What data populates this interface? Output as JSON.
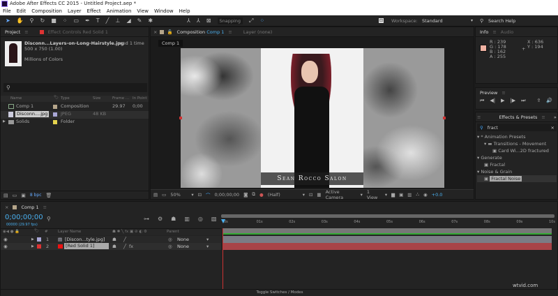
{
  "window": {
    "title": "Adobe After Effects CC 2015 - Untitled Project.aep *"
  },
  "menu": [
    "File",
    "Edit",
    "Composition",
    "Layer",
    "Effect",
    "Animation",
    "View",
    "Window",
    "Help"
  ],
  "toolbar": {
    "snapping": "Snapping",
    "workspace_label": "Workspace:",
    "workspace_value": "Standard",
    "search_help": "Search Help"
  },
  "project": {
    "tab": "Project",
    "effect_controls_tab": "Effect Controls Red Solid 1",
    "item_name": "Disconn...Layers-on-Long-Hairstyle.jpg",
    "used": ", used 1 time",
    "dimensions": "500 x 750 (1.00)",
    "colors": "Millions of Colors",
    "columns": [
      "Name",
      "Type",
      "Size",
      "Frame ...",
      "In Point"
    ],
    "items": [
      {
        "name": "Comp 1",
        "type": "Composition",
        "size": "",
        "frame": "29.97",
        "in": "0;00",
        "color": "#b5a58a"
      },
      {
        "name": "Disconn....jpg",
        "type": "JPEG",
        "size": "48 KB",
        "frame": "",
        "in": "",
        "color": "#a9a7d6"
      },
      {
        "name": "Solids",
        "type": "Folder",
        "size": "",
        "frame": "",
        "in": "",
        "color": "#e4d34d"
      }
    ],
    "bpc": "8 bpc"
  },
  "composition": {
    "tab_label": "Composition",
    "tab_comp": "Comp 1",
    "layer_tab": "Layer (none)",
    "breadcrumb": "Comp 1",
    "banner": "Sean Rocco Salon",
    "footer": {
      "zoom": "50%",
      "timecode": "0;00;00;00",
      "resolution": "(Half)",
      "camera": "Active Camera",
      "view": "1 View",
      "exposure": "+0.0"
    }
  },
  "info": {
    "tab": "Info",
    "audio_tab": "Audio",
    "swatch": "#efb2a2",
    "r": "R : 239",
    "g": "G : 178",
    "b": "B : 162",
    "a": "A : 255",
    "x": "X : 636",
    "y": "Y : 194"
  },
  "preview": {
    "tab": "Preview"
  },
  "effects": {
    "tab": "Effects & Presets",
    "search": "fract",
    "tree": [
      {
        "label": "* Animation Presets",
        "level": 0
      },
      {
        "label": "Transitions - Movement",
        "level": 1
      },
      {
        "label": "Card Wi...2D fractured",
        "level": 2
      },
      {
        "label": "Generate",
        "level": 0
      },
      {
        "label": "Fractal",
        "level": 1
      },
      {
        "label": "Noise & Grain",
        "level": 0
      },
      {
        "label": "Fractal Noise",
        "level": 1,
        "selected": true
      }
    ]
  },
  "timeline": {
    "tab": "Comp 1",
    "timecode": "0;00;00;00",
    "fps": "00000 (29.97 fps)",
    "col_layer_name": "Layer Name",
    "col_parent": "Parent",
    "col_num": "#",
    "layers": [
      {
        "num": "1",
        "name": "[Discon...tyle.jpg]",
        "parent": "None",
        "color": "#a9a7d6"
      },
      {
        "num": "2",
        "name": "[Red Solid 1]",
        "parent": "None",
        "color": "#d22"
      }
    ],
    "ruler": [
      "0s",
      "01s",
      "02s",
      "03s",
      "04s",
      "05s",
      "06s",
      "07s",
      "08s",
      "09s",
      "10s"
    ],
    "toggle": "Toggle Switches / Modes"
  },
  "watermark": "wtvid.com"
}
